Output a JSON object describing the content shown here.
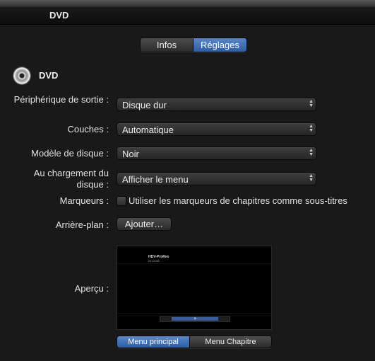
{
  "window": {
    "title": "DVD"
  },
  "tabs": [
    {
      "label": "Infos",
      "active": false
    },
    {
      "label": "Réglages",
      "active": true
    }
  ],
  "section": {
    "title": "DVD",
    "icon": "dvd-disc-icon"
  },
  "fields": {
    "output_device": {
      "label": "Périphérique de sortie :",
      "value": "Disque dur"
    },
    "layers": {
      "label": "Couches :",
      "value": "Automatique"
    },
    "disc_template": {
      "label": "Modèle de disque :",
      "value": "Noir"
    },
    "on_load": {
      "label": "Au chargement du disque :",
      "value": "Afficher le menu"
    },
    "markers": {
      "label": "Marqueurs :",
      "checkbox_label": "Utiliser les marqueurs de chapitres comme sous-titres",
      "checked": false
    },
    "background": {
      "label": "Arrière-plan :",
      "button_label": "Ajouter…"
    },
    "preview": {
      "label": "Aperçu :",
      "thumb_title": "HDV-ProRes",
      "thumb_time": "01:22:58"
    }
  },
  "menu_tabs": [
    {
      "label": "Menu principal",
      "active": true
    },
    {
      "label": "Menu Chapitre",
      "active": false
    }
  ],
  "colors": {
    "accent": "#3d6db5",
    "background": "#191919"
  }
}
